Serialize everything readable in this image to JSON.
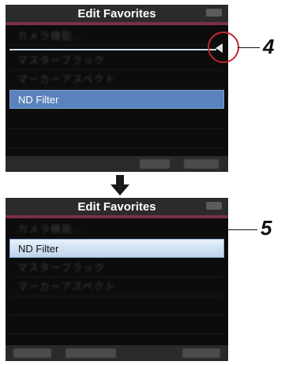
{
  "screen1": {
    "title": "Edit Favorites",
    "rows": [
      "カメラ機能...",
      "マスターブラック",
      "マーカーアスペクト",
      "ND Filter"
    ],
    "selected_label": "ND Filter"
  },
  "screen2": {
    "title": "Edit Favorites",
    "rows": [
      "カメラ機能...",
      "ND Filter",
      "マスターブラック",
      "マーカーアスペクト"
    ],
    "selected_label": "ND Filter"
  },
  "callouts": {
    "first": "4",
    "second": "5"
  },
  "icons": {
    "arrow": "down-arrow-icon",
    "insert_marker": "triangle-left-icon"
  },
  "colors": {
    "accent": "#7a2f4c",
    "selection": "#5a83bd",
    "highlight_circle": "#c4262e"
  }
}
